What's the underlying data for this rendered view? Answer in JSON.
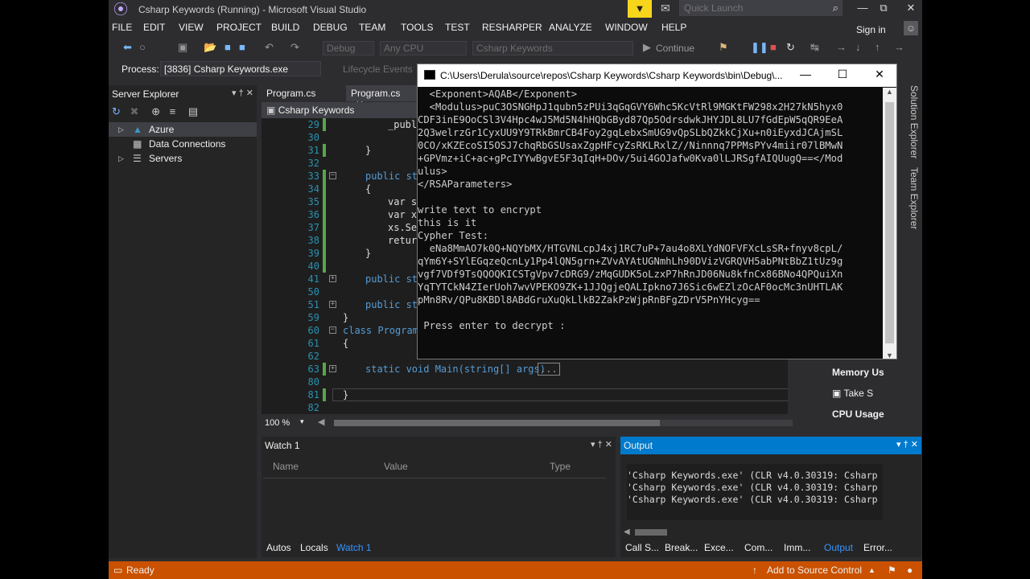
{
  "title": "Csharp Keywords (Running) - Microsoft Visual Studio",
  "quick_launch_placeholder": "Quick Launch",
  "menu": [
    "FILE",
    "EDIT",
    "VIEW",
    "PROJECT",
    "BUILD",
    "DEBUG",
    "TEAM",
    "TOOLS",
    "TEST",
    "RESHARPER",
    "ANALYZE",
    "WINDOW",
    "HELP"
  ],
  "sign_in": "Sign in",
  "toolbar": {
    "config": "Debug",
    "platform": "Any CPU",
    "project": "Csharp Keywords",
    "continue": "Continue"
  },
  "process": {
    "label": "Process:",
    "value": "[3836] Csharp Keywords.exe",
    "lifecycle": "Lifecycle Events"
  },
  "server_explorer": {
    "title": "Server Explorer",
    "items": [
      "Azure",
      "Data Connections",
      "Servers"
    ]
  },
  "tabs": [
    "Program.cs",
    "Program.cs"
  ],
  "editor_header": "Csharp Keywords",
  "code_lines": [
    {
      "n": "29",
      "t": "_publ"
    },
    {
      "n": "30",
      "t": ""
    },
    {
      "n": "31",
      "t": "}"
    },
    {
      "n": "32",
      "t": ""
    },
    {
      "n": "33",
      "t": "public st"
    },
    {
      "n": "34",
      "t": "{"
    },
    {
      "n": "35",
      "t": "var s"
    },
    {
      "n": "36",
      "t": "var x"
    },
    {
      "n": "37",
      "t": "xs.Se"
    },
    {
      "n": "38",
      "t": "retur"
    },
    {
      "n": "39",
      "t": "}"
    },
    {
      "n": "40",
      "t": ""
    },
    {
      "n": "41",
      "t": "public st"
    },
    {
      "n": "50",
      "t": ""
    },
    {
      "n": "51",
      "t": "public st"
    },
    {
      "n": "59",
      "t": "}"
    },
    {
      "n": "60",
      "t": "class Program"
    },
    {
      "n": "61",
      "t": "{"
    },
    {
      "n": "62",
      "t": ""
    },
    {
      "n": "63",
      "t": "static void Main(string[] args)"
    },
    {
      "n": "80",
      "t": ""
    },
    {
      "n": "81",
      "t": "}"
    },
    {
      "n": "82",
      "t": ""
    }
  ],
  "collapsed_marker": "...",
  "zoom": "100 %",
  "diagnostics": {
    "memory": "Memory Us",
    "take": "Take S",
    "cpu": "CPU Usage"
  },
  "watch": {
    "title": "Watch 1",
    "cols": [
      "Name",
      "Value",
      "Type"
    ],
    "tabs": [
      "Autos",
      "Locals",
      "Watch 1"
    ]
  },
  "output": {
    "title": "Output",
    "lines": [
      "'Csharp Keywords.exe' (CLR v4.0.30319: Csharp",
      "'Csharp Keywords.exe' (CLR v4.0.30319: Csharp",
      "'Csharp Keywords.exe' (CLR v4.0.30319: Csharp"
    ],
    "tabs": [
      "Call S...",
      "Break...",
      "Exce...",
      "Com...",
      "Imm...",
      "Output",
      "Error..."
    ]
  },
  "status": {
    "ready": "Ready",
    "source": "Add to Source Control"
  },
  "side_tabs": [
    "Solution Explorer",
    "Team Explorer"
  ],
  "console": {
    "title": "C:\\Users\\Derula\\source\\repos\\Csharp Keywords\\Csharp Keywords\\bin\\Debug\\...",
    "lines": [
      "  <Exponent>AQAB</Exponent>",
      "  <Modulus>puC3OSNGHpJ1qubn5zPUi3qGqGVY6Whc5KcVtRl9MGKtFW298x2H27kN5hyx0",
      "CDF3inE9OoCSl3V4Hpc4wJ5Md5N4hHQbGByd87Qp5OdrsdwkJHYJDL8LU7fGdEpW5qQR9EeA",
      "2Q3welrzGr1CyxUU9Y9TRkBmrCB4Foy2gqLebxSmUG9vQpSLbQZkkCjXu+n0iEyxdJCAjmSL",
      "0CO/xKZEcoSI5OSJ7chqRbGSUsaxZgpHFcyZsRKLRxlZ//Ninnnq7PPMsPYv4miir07lBMwN",
      "+GPVmz+iC+ac+gPcIYYwBgvE5F3qIqH+DOv/5ui4GOJafw0Kva0lLJRSgfAIQUugQ==</Mod",
      "ulus>",
      "</RSAParameters>",
      "",
      "write text to encrypt",
      "this is it",
      "Cypher Test:",
      "  eNa8MmAO7k0Q+NQYbMX/HTGVNLcpJ4xj1RC7uP+7au4o8XLYdNOFVFXcLsSR+fnyv8cpL/",
      "qYm6Y+SYlEGqzeQcnLy1Pp4lQN5grn+ZVvAYAtUGNmhLh90DVizVGRQVH5abPNtBbZ1tUz9g",
      "vgf7VDf9TsQQOQKICSTgVpv7cDRG9/zMqGUDK5oLzxP7hRnJD06Nu8kfnCx86BNo4QPQuiXn",
      "YqTYTCkN4ZIerUoh7wvVPEKO9ZK+1JJQgjeQALIpkno7J6Sic6wEZlzOcAF0ocMc3nUHTLAK",
      "pMn8Rv/QPu8KBDl8ABdGruXuQkLlkB2ZakPzWjpRnBFgZDrV5PnYHcyg==",
      "",
      " Press enter to decrypt :"
    ]
  }
}
